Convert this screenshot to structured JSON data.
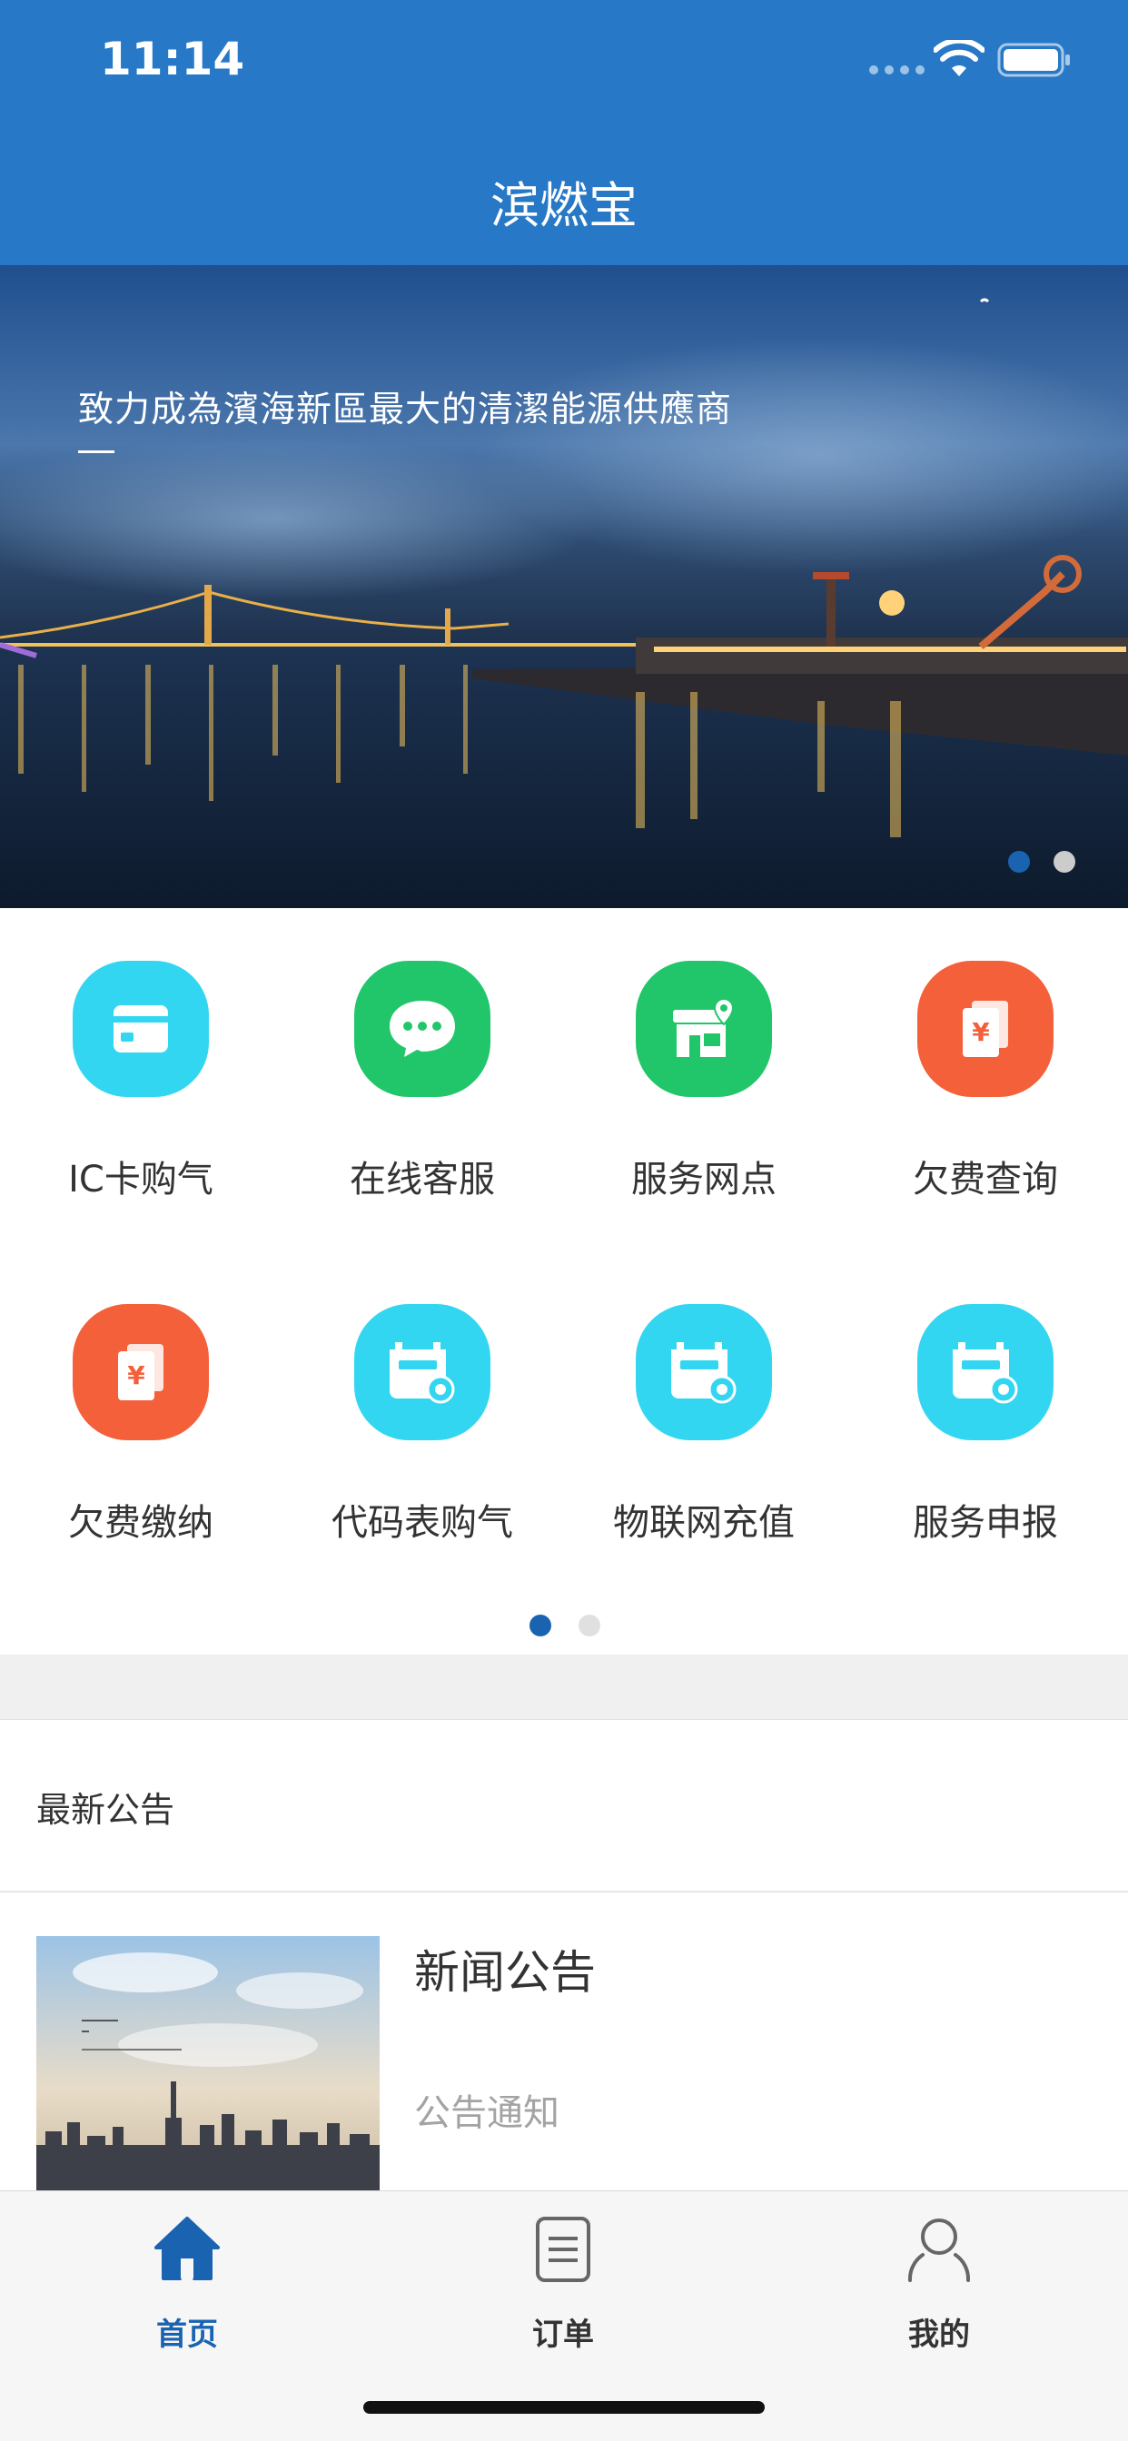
{
  "status_bar": {
    "time": "11:14"
  },
  "header": {
    "title": "滨燃宝"
  },
  "banner": {
    "slogan": "致力成為濱海新區最大的清潔能源供應商",
    "page_count": 2,
    "active_page": 1
  },
  "grid": {
    "items": [
      {
        "label": "IC卡购气",
        "icon": "card-icon",
        "color": "#33d6f0"
      },
      {
        "label": "在线客服",
        "icon": "chat-icon",
        "color": "#22c66a"
      },
      {
        "label": "服务网点",
        "icon": "store-location-icon",
        "color": "#22c66a"
      },
      {
        "label": "欠费查询",
        "icon": "bill-query-icon",
        "color": "#f4603a"
      },
      {
        "label": "欠费缴纳",
        "icon": "bill-pay-icon",
        "color": "#f4603a"
      },
      {
        "label": "代码表购气",
        "icon": "gas-meter-icon",
        "color": "#33d6f0"
      },
      {
        "label": "物联网充值",
        "icon": "gas-meter-icon",
        "color": "#33d6f0"
      },
      {
        "label": "服务申报",
        "icon": "gas-meter-icon",
        "color": "#33d6f0"
      }
    ],
    "page_count": 2,
    "active_page": 1
  },
  "announcements": {
    "section_title": "最新公告",
    "items": [
      {
        "title": "新闻公告",
        "subtitle": "公告通知"
      }
    ]
  },
  "tabbar": {
    "tabs": [
      {
        "label": "首页",
        "icon": "home-icon",
        "active": true
      },
      {
        "label": "订单",
        "icon": "order-list-icon",
        "active": false
      },
      {
        "label": "我的",
        "icon": "user-icon",
        "active": false
      }
    ],
    "active_color": "#1a63b0",
    "inactive_color": "#333333"
  }
}
